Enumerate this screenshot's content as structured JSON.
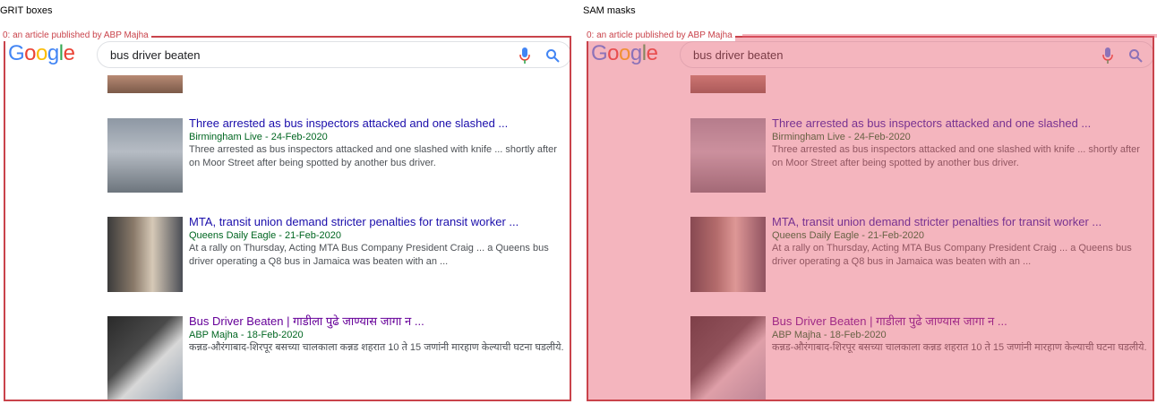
{
  "panels": {
    "grit_title": "GRIT boxes",
    "sam_title": "SAM masks"
  },
  "annotation": {
    "label": "0: an article published by ABP Majha",
    "color": "#c9434b"
  },
  "search": {
    "query": "bus driver beaten",
    "logo": [
      "G",
      "o",
      "o",
      "g",
      "l",
      "e"
    ]
  },
  "results": [
    {
      "title": "Three arrested as bus inspectors attacked and one slashed ...",
      "source": "Birmingham Live - 24-Feb-2020",
      "snippet": "Three arrested as bus inspectors attacked and one slashed with knife ... shortly after on Moor Street after being spotted by another bus driver."
    },
    {
      "title": "MTA, transit union demand stricter penalties for transit worker ...",
      "source": "Queens Daily Eagle - 21-Feb-2020",
      "snippet": "At a rally on Thursday, Acting MTA Bus Company President Craig ... a Queens bus driver operating a Q8 bus in Jamaica was beaten with an ..."
    },
    {
      "title": "Bus Driver Beaten | गाडीला पुढे जाण्यास जागा न ...",
      "source": "ABP Majha - 18-Feb-2020",
      "snippet": "कन्नड-औरंगाबाद-शिरपूर बसच्या चालकाला कन्नड शहरात 10 ते 15 जणांनी मारहाण केल्याची घटना घडलीये."
    }
  ]
}
